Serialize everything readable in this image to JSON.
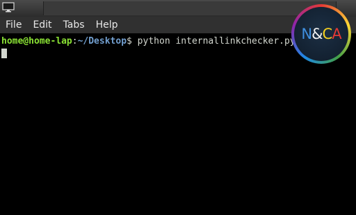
{
  "menu": {
    "items": [
      {
        "label": "File"
      },
      {
        "label": "Edit"
      },
      {
        "label": "Tabs"
      },
      {
        "label": "Help"
      }
    ]
  },
  "terminal": {
    "prompt_user": "home@home-lap",
    "prompt_colon": ":",
    "prompt_path": "~/Desktop",
    "prompt_symbol": "$",
    "command": " python internallinkchecker.py"
  },
  "badge": {
    "n": "N",
    "amp": "&",
    "c": "C",
    "a": "A"
  },
  "colors": {
    "prompt_user": "#8ae234",
    "prompt_path": "#729fcf",
    "terminal_bg": "#000000",
    "menubar_bg": "#303030"
  },
  "icons": {
    "app": "monitor-icon"
  }
}
